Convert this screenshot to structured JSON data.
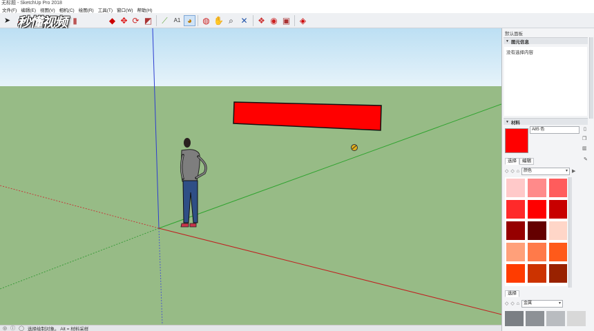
{
  "window": {
    "title": "无标题 - SketchUp Pro 2018"
  },
  "menu": [
    "文件(F)",
    "编辑(E)",
    "视图(V)",
    "相机(C)",
    "绘图(R)",
    "工具(T)",
    "窗口(W)",
    "帮助(H)"
  ],
  "watermark": "秒懂视频",
  "panel": {
    "title": "默认面板",
    "entity_info": {
      "header": "图元信息",
      "empty_text": "没有选择内容"
    },
    "materials": {
      "header": "材料",
      "current_name": "A85 色",
      "current_color": "#ff0000",
      "tabs": [
        "选择",
        "编辑"
      ],
      "collection_select": "颜色",
      "palette": [
        "#ffc9c9",
        "#ff8a8a",
        "#ff5c5c",
        "#ff2a2a",
        "#ff0000",
        "#c80000",
        "#960000",
        "#640000",
        "#ffd6c8",
        "#ffa07a",
        "#ff7a4a",
        "#ff5a1a",
        "#ff3c00",
        "#cc3300",
        "#992200"
      ],
      "secondary": {
        "tab": "选择",
        "collection_select": "金属",
        "textures": [
          "#7b7f84",
          "#8d9196",
          "#b9bcc0",
          "#d8d8d8"
        ]
      }
    }
  },
  "status": {
    "text": "选择绘制对象。 Alt = 材料采样"
  },
  "colors": {
    "ground": "#97bb86",
    "sky_top": "#bcdff3",
    "sky_bottom": "#e6f3fa",
    "block": "#ff0000",
    "accent": "#7da7d6"
  }
}
